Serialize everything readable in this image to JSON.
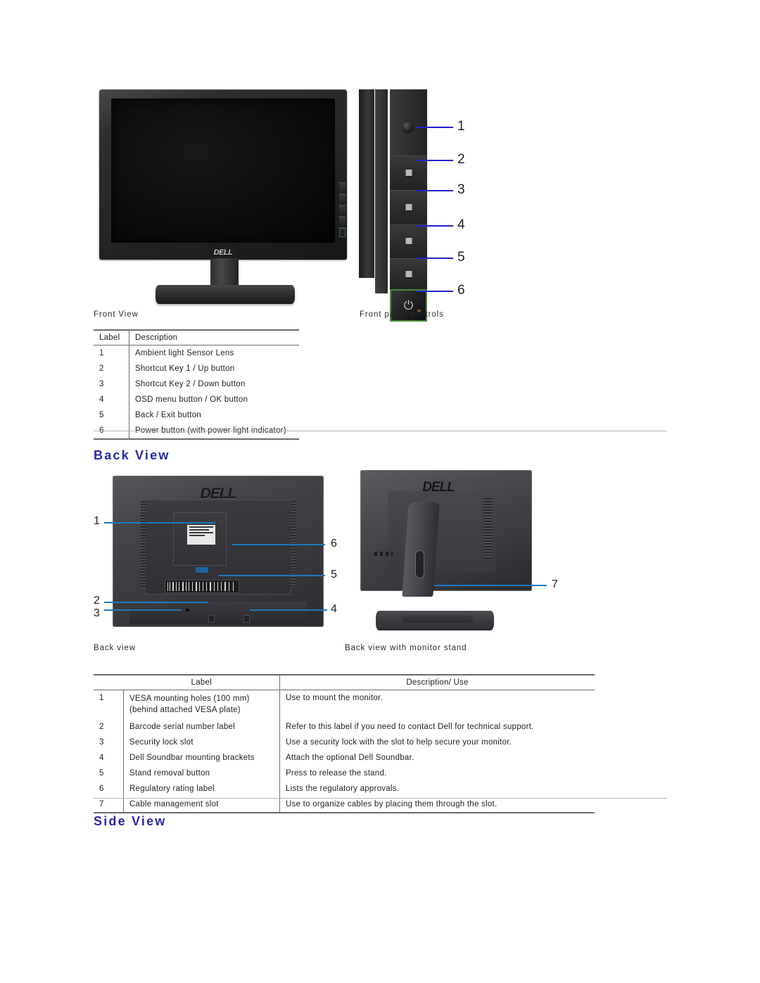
{
  "sections": {
    "back_view_heading": "Back View",
    "side_view_heading": "Side View"
  },
  "front_figure": {
    "caption_left": "Front View",
    "caption_right": "Front panel controls",
    "monitor_logo": "DELL",
    "power_glyph": "⏻",
    "callouts": [
      "1",
      "2",
      "3",
      "4",
      "5",
      "6"
    ],
    "leader_color": "#2222cc"
  },
  "front_table": {
    "headers": [
      "Label",
      "Description"
    ],
    "rows": [
      {
        "label": "1",
        "description": "Ambient light Sensor Lens"
      },
      {
        "label": "2",
        "description": "Shortcut Key 1 / Up button"
      },
      {
        "label": "3",
        "description": "Shortcut Key 2 / Down button"
      },
      {
        "label": "4",
        "description": "OSD menu button / OK button"
      },
      {
        "label": "5",
        "description": "Back / Exit button"
      },
      {
        "label": "6",
        "description": "Power button (with power light indicator)"
      }
    ]
  },
  "back_figure": {
    "caption_left": "Back view",
    "caption_right": "Back view with monitor stand",
    "monitor_logo": "DELL",
    "callouts_left": [
      "1",
      "2",
      "3",
      "4",
      "5",
      "6"
    ],
    "callouts_right": [
      "7"
    ],
    "leader_color": "#1a7ac4"
  },
  "back_table": {
    "headers": [
      "Label",
      "Description/ Use"
    ],
    "rows": [
      {
        "num": "1",
        "label": "VESA mounting holes (100 mm)\n(behind attached VESA plate)",
        "description": "Use to mount the monitor."
      },
      {
        "num": "2",
        "label": "Barcode serial number label",
        "description": "Refer to this label if you need to contact Dell for technical support."
      },
      {
        "num": "3",
        "label": "Security lock slot",
        "description": "Use a security lock with the slot to help secure your monitor."
      },
      {
        "num": "4",
        "label": "Dell Soundbar mounting brackets",
        "description": "Attach the optional Dell Soundbar."
      },
      {
        "num": "5",
        "label": "Stand removal button",
        "description": "Press to release the stand."
      },
      {
        "num": "6",
        "label": "Regulatory rating label",
        "description": "Lists the regulatory approvals."
      },
      {
        "num": "7",
        "label": "Cable management slot",
        "description": "Use to organize cables by placing them through the slot."
      }
    ]
  },
  "colors": {
    "heading_blue": "#2a2aa8",
    "rule_gray": "#b9b9b9",
    "table_border": "#6b6b6b",
    "power_button_highlight": "#4d8a3c"
  }
}
